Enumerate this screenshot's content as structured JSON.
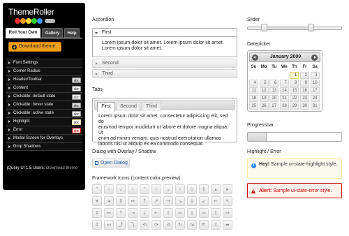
{
  "sidebar": {
    "logo_text": "ThemeRoller",
    "tabs": [
      "Roll Your Own",
      "Gallery",
      "Help"
    ],
    "download_label": "Download theme",
    "sections": [
      {
        "label": "Font Settings",
        "swatch": ""
      },
      {
        "label": "Corner Radius",
        "swatch": ""
      },
      {
        "label": "Header/Toolbar",
        "swatch": "abc"
      },
      {
        "label": "Content",
        "swatch": "abc"
      },
      {
        "label": "Clickable: default state",
        "swatch": "abc"
      },
      {
        "label": "Clickable: hover state",
        "swatch": "abc"
      },
      {
        "label": "Clickable: active state",
        "swatch": "abc"
      },
      {
        "label": "Highlight",
        "swatch": "abc"
      },
      {
        "label": "Error",
        "swatch": "abc"
      },
      {
        "label": "Modal Screen for Overlays",
        "swatch": ""
      },
      {
        "label": "Drop Shadows",
        "swatch": ""
      }
    ],
    "footer_users": "jQuery UI 1.5 Users:",
    "footer_link": "Download theme"
  },
  "accordion": {
    "title": "Accordion",
    "sections": [
      "First",
      "Second",
      "Third"
    ],
    "content_line1": "Lorem ipsum dolor sit amet. Lorem ipsum dolor sit amet.",
    "content_line2": "Lorem ipsum dolor sit amet."
  },
  "tabs": {
    "title": "Tabs",
    "labels": [
      "First",
      "Second",
      "Third"
    ],
    "line1": "Lorem ipsum dolor sit amet, consectetur adipisicing elit, sed do",
    "line2": "eiusmod tempor incididunt ut labore et dolore magna aliqua. Ut",
    "line3": "enim ad minim veniam, quis nostrud exercitation ullamco",
    "line4": "laboris nisi ut aliquip ex ea commodo consequat."
  },
  "dialog": {
    "title": "Dialog with Overlay / Shadow",
    "button_label": "Open Dialog"
  },
  "icons": {
    "title": "Framework Icons (content color preview)",
    "glyphs": [
      "⌃",
      "›",
      "⌄",
      "‹",
      "⌃",
      "›",
      "⌄",
      "‹",
      "◇",
      "↕",
      "▴",
      "▸",
      "▾",
      "◂",
      "⇕",
      "⇔",
      "↑",
      "↗",
      "→",
      "↘",
      "↓",
      "↙",
      "←",
      "↖",
      "↕",
      "↔",
      "⇡",
      "⇢",
      "⇣",
      "⇠",
      "⇧",
      "⇨",
      "⇩",
      "⇦",
      "↥",
      "↦",
      "↧",
      "↤",
      "⤴",
      "⤵",
      "⟲",
      "⟳",
      "↺",
      "↻",
      "⇲",
      "⇱",
      "⇳",
      "⬌"
    ]
  },
  "slider": {
    "title": "Slider",
    "range_start": 0.17,
    "range_end": 0.67
  },
  "datepicker": {
    "title": "Datepicker",
    "month_label": "January 2009",
    "weekdays": [
      "Su",
      "Mo",
      "Tu",
      "We",
      "Th",
      "Fr",
      "Sa"
    ],
    "days": [
      "1",
      "2",
      "3",
      "4",
      "5",
      "6",
      "7",
      "8",
      "9",
      "10",
      "11",
      "12",
      "13",
      "14",
      "15",
      "16",
      "17",
      "18",
      "19",
      "20",
      "21",
      "22",
      "23",
      "24",
      "25",
      "26",
      "27",
      "28",
      "29",
      "30",
      "31"
    ],
    "first_weekday_index": 4,
    "today": "1"
  },
  "progressbar": {
    "title": "Progressbar",
    "value": 0.2
  },
  "highlight": {
    "title": "Highlight / Error",
    "strong": "Hey!",
    "text": "Sample ui-state-highlight style."
  },
  "error": {
    "strong": "Alert:",
    "text": "Sample ui-state-error style."
  },
  "colors": {
    "download": "#f0a018",
    "link": "#1b5fa8",
    "error": "#cd0a0a",
    "highlight_bg": "#fbf9ee"
  }
}
